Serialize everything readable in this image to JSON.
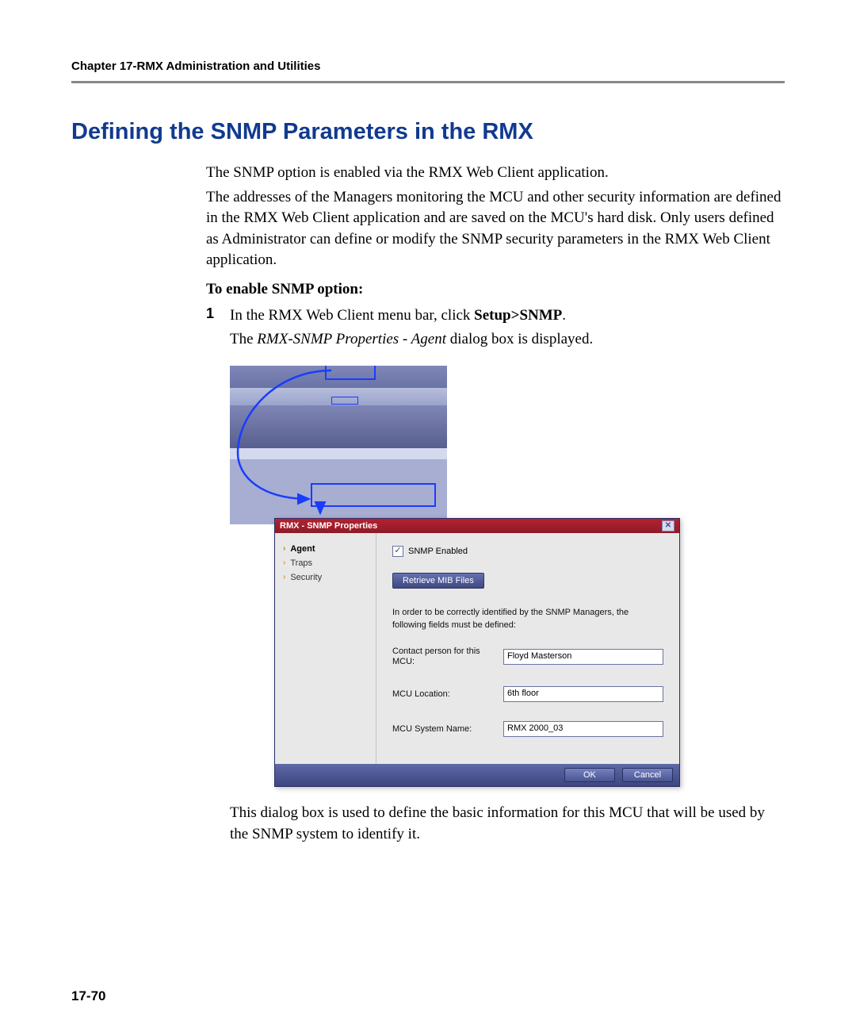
{
  "header": {
    "running": "Chapter 17-RMX Administration and Utilities"
  },
  "title": "Defining the SNMP Parameters in the RMX",
  "paragraphs": {
    "p1": "The SNMP option is enabled via the RMX Web Client application.",
    "p2": "The addresses of the Managers monitoring the MCU and other security information are defined in the RMX Web Client application and are saved on the MCU's hard disk. Only users defined as Administrator can define or modify the SNMP security parameters in the RMX Web Client application.",
    "p3": "To enable SNMP option:",
    "step1_prefix": "In the RMX Web Client menu bar, click ",
    "step1_bold": "Setup>SNMP",
    "step1_suffix": ".",
    "step1_num": "1",
    "step1b_pre": "The ",
    "step1b_italic": "RMX-SNMP Properties - Agent",
    "step1b_post": " dialog box is displayed.",
    "p4": "This dialog box is used to define the basic information for this MCU that will be used by the SNMP system to identify it."
  },
  "dialog": {
    "title": "RMX - SNMP Properties",
    "nav": {
      "agent": "Agent",
      "traps": "Traps",
      "security": "Security"
    },
    "snmp_enabled_label": "SNMP Enabled",
    "retrieve_btn": "Retrieve MIB Files",
    "explain": "In order to be correctly identified by the SNMP Managers, the following fields must be defined:",
    "fields": {
      "contact_label": "Contact person for this MCU:",
      "contact_value": "Floyd Masterson",
      "location_label": "MCU Location:",
      "location_value": "6th floor",
      "sysname_label": "MCU System Name:",
      "sysname_value": "RMX 2000_03"
    },
    "buttons": {
      "ok": "OK",
      "cancel": "Cancel"
    },
    "close_glyph": "✕"
  },
  "page_number": "17-70"
}
